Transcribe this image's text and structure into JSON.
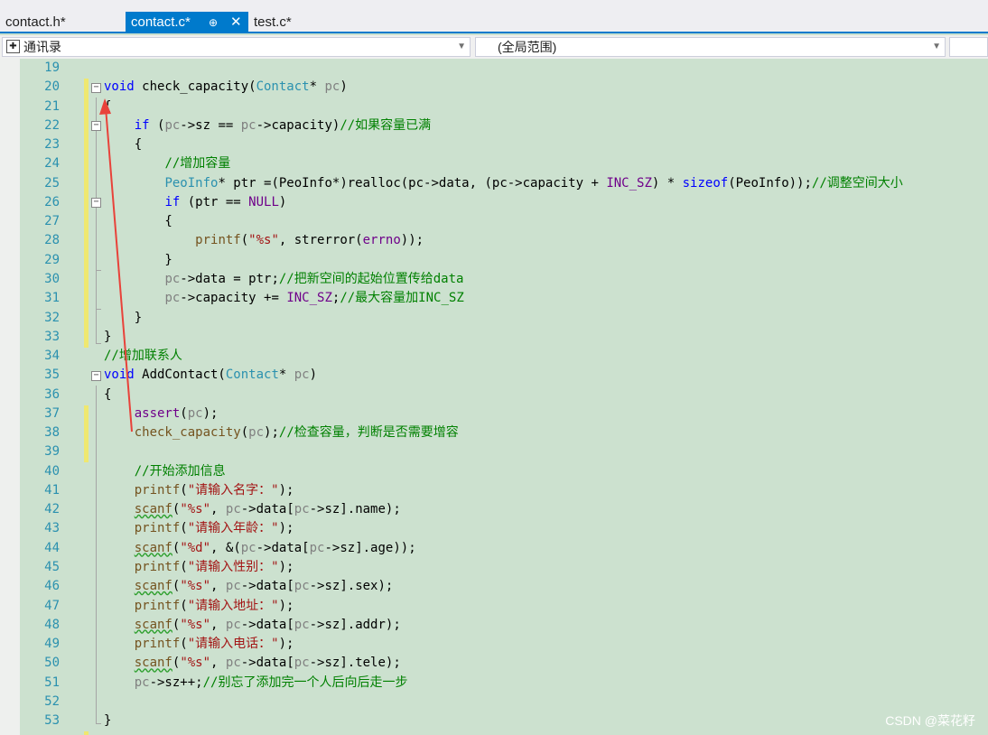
{
  "tabs": [
    {
      "label": "contact.h*"
    },
    {
      "label": "contact.c*"
    },
    {
      "label": "test.c*"
    }
  ],
  "active_tab_pin": "⊕",
  "active_tab_close": "✕",
  "nav": {
    "scope_left": "通讯录",
    "scope_right": "(全局范围)"
  },
  "watermark": "CSDN @菜花籽",
  "code_lines": [
    {
      "num": "19",
      "segs": []
    },
    {
      "num": "20",
      "segs": [
        {
          "t": "void",
          "c": "kw"
        },
        {
          "t": " check_capacity(",
          "c": ""
        },
        {
          "t": "Contact",
          "c": "ty"
        },
        {
          "t": "* ",
          "c": ""
        },
        {
          "t": "pc",
          "c": "pr"
        },
        {
          "t": ")",
          "c": ""
        }
      ]
    },
    {
      "num": "21",
      "segs": [
        {
          "t": "{",
          "c": ""
        }
      ]
    },
    {
      "num": "22",
      "segs": [
        {
          "t": "    ",
          "c": ""
        },
        {
          "t": "if",
          "c": "kw"
        },
        {
          "t": " (",
          "c": ""
        },
        {
          "t": "pc",
          "c": "pr"
        },
        {
          "t": "->sz == ",
          "c": ""
        },
        {
          "t": "pc",
          "c": "pr"
        },
        {
          "t": "->capacity)",
          "c": ""
        },
        {
          "t": "//如果容量已满",
          "c": "cm"
        }
      ]
    },
    {
      "num": "23",
      "segs": [
        {
          "t": "    {",
          "c": ""
        }
      ]
    },
    {
      "num": "24",
      "segs": [
        {
          "t": "        ",
          "c": ""
        },
        {
          "t": "//增加容量",
          "c": "cm"
        }
      ]
    },
    {
      "num": "25",
      "segs": [
        {
          "t": "        ",
          "c": ""
        },
        {
          "t": "PeoInfo",
          "c": "ty"
        },
        {
          "t": "* ptr =(PeoInfo*)realloc(pc->data, (pc->capacity + ",
          "c": ""
        },
        {
          "t": "INC_SZ",
          "c": "mc"
        },
        {
          "t": ") * ",
          "c": ""
        },
        {
          "t": "sizeof",
          "c": "kw"
        },
        {
          "t": "(PeoInfo));",
          "c": ""
        },
        {
          "t": "//调整空间大小",
          "c": "cm"
        }
      ]
    },
    {
      "num": "26",
      "segs": [
        {
          "t": "        ",
          "c": ""
        },
        {
          "t": "if",
          "c": "kw"
        },
        {
          "t": " (ptr == ",
          "c": ""
        },
        {
          "t": "NULL",
          "c": "mc"
        },
        {
          "t": ")",
          "c": ""
        }
      ]
    },
    {
      "num": "27",
      "segs": [
        {
          "t": "        {",
          "c": ""
        }
      ]
    },
    {
      "num": "28",
      "segs": [
        {
          "t": "            ",
          "c": ""
        },
        {
          "t": "printf",
          "c": "fn"
        },
        {
          "t": "(",
          "c": ""
        },
        {
          "t": "\"%s\"",
          "c": "st"
        },
        {
          "t": ", strerror(",
          "c": ""
        },
        {
          "t": "errno",
          "c": "mc"
        },
        {
          "t": "));",
          "c": ""
        }
      ]
    },
    {
      "num": "29",
      "segs": [
        {
          "t": "        }",
          "c": ""
        }
      ]
    },
    {
      "num": "30",
      "segs": [
        {
          "t": "        ",
          "c": ""
        },
        {
          "t": "pc",
          "c": "pr"
        },
        {
          "t": "->data = ptr;",
          "c": ""
        },
        {
          "t": "//把新空间的起始位置传给data",
          "c": "cm"
        }
      ]
    },
    {
      "num": "31",
      "segs": [
        {
          "t": "        ",
          "c": ""
        },
        {
          "t": "pc",
          "c": "pr"
        },
        {
          "t": "->capacity += ",
          "c": ""
        },
        {
          "t": "INC_SZ",
          "c": "mc"
        },
        {
          "t": ";",
          "c": ""
        },
        {
          "t": "//最大容量加INC_SZ",
          "c": "cm"
        }
      ]
    },
    {
      "num": "32",
      "segs": [
        {
          "t": "    }",
          "c": ""
        }
      ]
    },
    {
      "num": "33",
      "segs": [
        {
          "t": "}",
          "c": ""
        }
      ]
    },
    {
      "num": "34",
      "segs": [
        {
          "t": "//增加联系人",
          "c": "cm"
        }
      ]
    },
    {
      "num": "35",
      "segs": [
        {
          "t": "void",
          "c": "kw"
        },
        {
          "t": " AddContact(",
          "c": ""
        },
        {
          "t": "Contact",
          "c": "ty"
        },
        {
          "t": "* ",
          "c": ""
        },
        {
          "t": "pc",
          "c": "pr"
        },
        {
          "t": ")",
          "c": ""
        }
      ]
    },
    {
      "num": "36",
      "segs": [
        {
          "t": "{",
          "c": ""
        }
      ]
    },
    {
      "num": "37",
      "segs": [
        {
          "t": "    ",
          "c": ""
        },
        {
          "t": "assert",
          "c": "mc"
        },
        {
          "t": "(",
          "c": ""
        },
        {
          "t": "pc",
          "c": "pr"
        },
        {
          "t": ");",
          "c": ""
        }
      ]
    },
    {
      "num": "38",
      "segs": [
        {
          "t": "    ",
          "c": ""
        },
        {
          "t": "check_capacity",
          "c": "fn"
        },
        {
          "t": "(",
          "c": ""
        },
        {
          "t": "pc",
          "c": "pr"
        },
        {
          "t": ");",
          "c": ""
        },
        {
          "t": "//检查容量，判断是否需要增容",
          "c": "cm"
        }
      ]
    },
    {
      "num": "39",
      "segs": []
    },
    {
      "num": "40",
      "segs": [
        {
          "t": "    ",
          "c": ""
        },
        {
          "t": "//开始添加信息",
          "c": "cm"
        }
      ]
    },
    {
      "num": "41",
      "segs": [
        {
          "t": "    ",
          "c": ""
        },
        {
          "t": "printf",
          "c": "fn"
        },
        {
          "t": "(",
          "c": ""
        },
        {
          "t": "\"请输入名字：\"",
          "c": "st"
        },
        {
          "t": ");",
          "c": ""
        }
      ]
    },
    {
      "num": "42",
      "segs": [
        {
          "t": "    ",
          "c": ""
        },
        {
          "t": "scanf",
          "c": "fn sq"
        },
        {
          "t": "(",
          "c": ""
        },
        {
          "t": "\"%s\"",
          "c": "st"
        },
        {
          "t": ", ",
          "c": ""
        },
        {
          "t": "pc",
          "c": "pr"
        },
        {
          "t": "->data[",
          "c": ""
        },
        {
          "t": "pc",
          "c": "pr"
        },
        {
          "t": "->sz].name);",
          "c": ""
        }
      ]
    },
    {
      "num": "43",
      "segs": [
        {
          "t": "    ",
          "c": ""
        },
        {
          "t": "printf",
          "c": "fn"
        },
        {
          "t": "(",
          "c": ""
        },
        {
          "t": "\"请输入年龄：\"",
          "c": "st"
        },
        {
          "t": ");",
          "c": ""
        }
      ]
    },
    {
      "num": "44",
      "segs": [
        {
          "t": "    ",
          "c": ""
        },
        {
          "t": "scanf",
          "c": "fn sq"
        },
        {
          "t": "(",
          "c": ""
        },
        {
          "t": "\"%d\"",
          "c": "st"
        },
        {
          "t": ", &(",
          "c": ""
        },
        {
          "t": "pc",
          "c": "pr"
        },
        {
          "t": "->data[",
          "c": ""
        },
        {
          "t": "pc",
          "c": "pr"
        },
        {
          "t": "->sz].age));",
          "c": ""
        }
      ]
    },
    {
      "num": "45",
      "segs": [
        {
          "t": "    ",
          "c": ""
        },
        {
          "t": "printf",
          "c": "fn"
        },
        {
          "t": "(",
          "c": ""
        },
        {
          "t": "\"请输入性别：\"",
          "c": "st"
        },
        {
          "t": ");",
          "c": ""
        }
      ]
    },
    {
      "num": "46",
      "segs": [
        {
          "t": "    ",
          "c": ""
        },
        {
          "t": "scanf",
          "c": "fn sq"
        },
        {
          "t": "(",
          "c": ""
        },
        {
          "t": "\"%s\"",
          "c": "st"
        },
        {
          "t": ", ",
          "c": ""
        },
        {
          "t": "pc",
          "c": "pr"
        },
        {
          "t": "->data[",
          "c": ""
        },
        {
          "t": "pc",
          "c": "pr"
        },
        {
          "t": "->sz].sex);",
          "c": ""
        }
      ]
    },
    {
      "num": "47",
      "segs": [
        {
          "t": "    ",
          "c": ""
        },
        {
          "t": "printf",
          "c": "fn"
        },
        {
          "t": "(",
          "c": ""
        },
        {
          "t": "\"请输入地址：\"",
          "c": "st"
        },
        {
          "t": ");",
          "c": ""
        }
      ]
    },
    {
      "num": "48",
      "segs": [
        {
          "t": "    ",
          "c": ""
        },
        {
          "t": "scanf",
          "c": "fn sq"
        },
        {
          "t": "(",
          "c": ""
        },
        {
          "t": "\"%s\"",
          "c": "st"
        },
        {
          "t": ", ",
          "c": ""
        },
        {
          "t": "pc",
          "c": "pr"
        },
        {
          "t": "->data[",
          "c": ""
        },
        {
          "t": "pc",
          "c": "pr"
        },
        {
          "t": "->sz].addr);",
          "c": ""
        }
      ]
    },
    {
      "num": "49",
      "segs": [
        {
          "t": "    ",
          "c": ""
        },
        {
          "t": "printf",
          "c": "fn"
        },
        {
          "t": "(",
          "c": ""
        },
        {
          "t": "\"请输入电话：\"",
          "c": "st"
        },
        {
          "t": ");",
          "c": ""
        }
      ]
    },
    {
      "num": "50",
      "segs": [
        {
          "t": "    ",
          "c": ""
        },
        {
          "t": "scanf",
          "c": "fn sq"
        },
        {
          "t": "(",
          "c": ""
        },
        {
          "t": "\"%s\"",
          "c": "st"
        },
        {
          "t": ", ",
          "c": ""
        },
        {
          "t": "pc",
          "c": "pr"
        },
        {
          "t": "->data[",
          "c": ""
        },
        {
          "t": "pc",
          "c": "pr"
        },
        {
          "t": "->sz].tele);",
          "c": ""
        }
      ]
    },
    {
      "num": "51",
      "segs": [
        {
          "t": "    ",
          "c": ""
        },
        {
          "t": "pc",
          "c": "pr"
        },
        {
          "t": "->sz++;",
          "c": ""
        },
        {
          "t": "//别忘了添加完一个人后向后走一步",
          "c": "cm"
        }
      ]
    },
    {
      "num": "52",
      "segs": []
    },
    {
      "num": "53",
      "segs": [
        {
          "t": "}",
          "c": ""
        }
      ]
    }
  ]
}
